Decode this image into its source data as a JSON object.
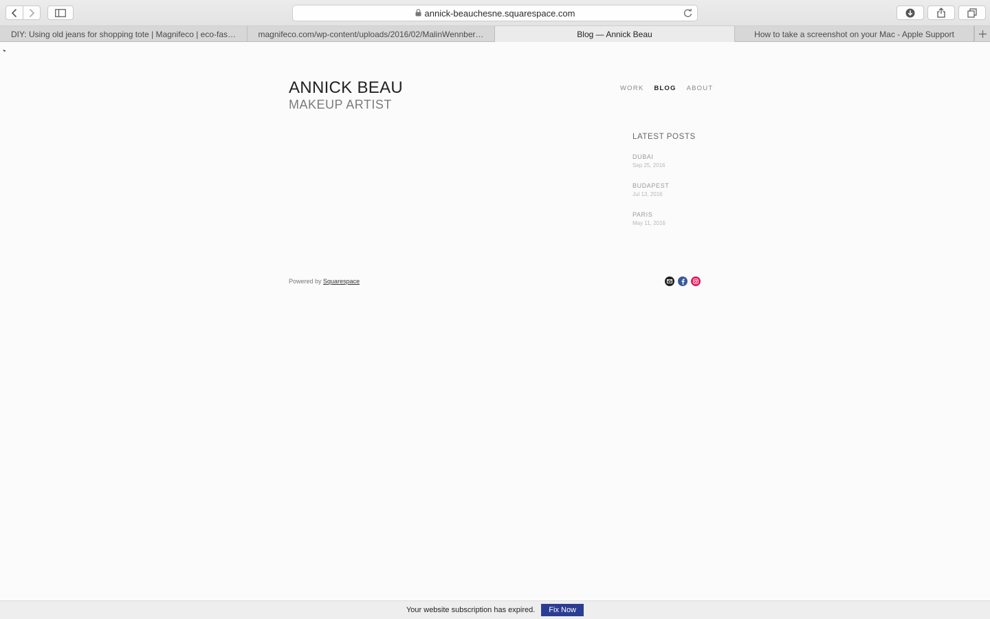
{
  "browser": {
    "url": "annick-beauchesne.squarespace.com",
    "tabs": [
      {
        "label": "DIY: Using old jeans for shopping tote | Magnifeco | eco-fas…",
        "active": false
      },
      {
        "label": "magnifeco.com/wp-content/uploads/2016/02/MalinWennber…",
        "active": false
      },
      {
        "label": "Blog — Annick Beau",
        "active": true
      },
      {
        "label": "How to take a screenshot on your Mac - Apple Support",
        "active": false
      }
    ]
  },
  "site": {
    "title": "ANNICK BEAU",
    "subtitle": "MAKEUP ARTIST",
    "nav": [
      {
        "label": "WORK",
        "current": false
      },
      {
        "label": "BLOG",
        "current": true
      },
      {
        "label": "ABOUT",
        "current": false
      }
    ]
  },
  "sidebar": {
    "heading": "LATEST POSTS",
    "posts": [
      {
        "title": "DUBAI",
        "date": "Sep 25, 2016"
      },
      {
        "title": "BUDAPEST",
        "date": "Jul 13, 2016"
      },
      {
        "title": "PARIS",
        "date": "May 11, 2016"
      }
    ]
  },
  "footer": {
    "powered_prefix": "Powered by",
    "powered_link": "Squarespace",
    "social": [
      {
        "icon": "email-icon",
        "color": "#222222"
      },
      {
        "icon": "facebook-icon",
        "color": "#3b5998"
      },
      {
        "icon": "instagram-icon",
        "color": "#e4175b"
      }
    ]
  },
  "banner": {
    "message": "Your website subscription has expired.",
    "button": "Fix Now",
    "button_color": "#2b3d93"
  }
}
